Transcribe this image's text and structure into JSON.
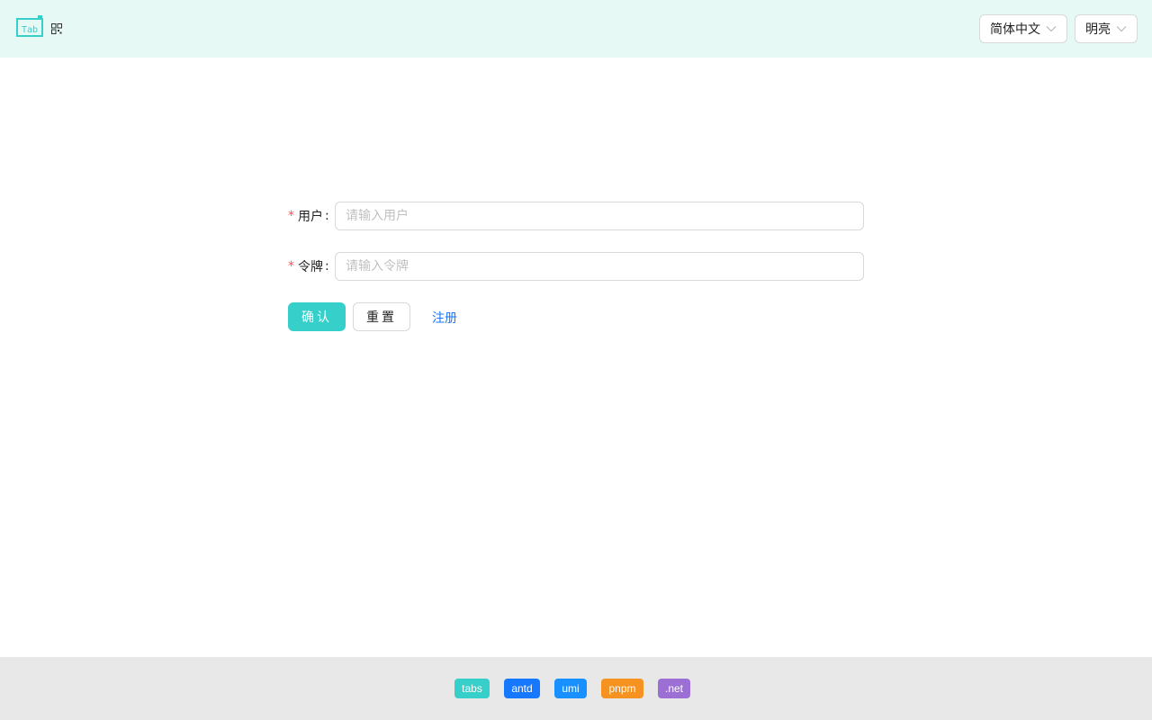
{
  "header": {
    "logo_text": "Tab",
    "language_select": {
      "value": "简体中文"
    },
    "theme_select": {
      "value": "明亮"
    }
  },
  "form": {
    "user": {
      "required_mark": "*",
      "label": "用户",
      "colon": ":",
      "placeholder": "请输入用户",
      "value": ""
    },
    "token": {
      "required_mark": "*",
      "label": "令牌",
      "colon": ":",
      "placeholder": "请输入令牌",
      "value": ""
    },
    "confirm_label": "确认",
    "reset_label": "重置",
    "register_label": "注册"
  },
  "footer": {
    "badges": [
      {
        "label": "tabs",
        "color": "#36cfc9"
      },
      {
        "label": "antd",
        "color": "#1677ff"
      },
      {
        "label": "umi",
        "color": "#1890ff"
      },
      {
        "label": "pnpm",
        "color": "#f69220"
      },
      {
        "label": ".net",
        "color": "#9b6fd3"
      }
    ]
  },
  "colors": {
    "header_bg": "#e6f9f5",
    "primary": "#36cfc9",
    "link": "#1677ff",
    "footer_bg": "#e8e8e8"
  }
}
